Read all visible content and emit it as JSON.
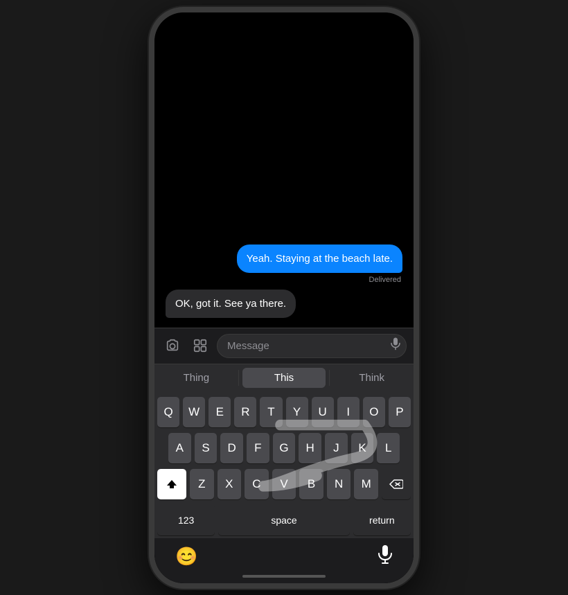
{
  "messages": [
    {
      "text": "Yeah. Staying at the beach late.",
      "type": "sent",
      "status": "Delivered"
    },
    {
      "text": "OK, got it. See ya there.",
      "type": "received"
    }
  ],
  "input": {
    "placeholder": "Message"
  },
  "autocomplete": {
    "left": "Thing",
    "center": "This",
    "right": "Think"
  },
  "keyboard": {
    "rows": [
      [
        "Q",
        "W",
        "E",
        "R",
        "T",
        "Y",
        "U",
        "I",
        "O",
        "P"
      ],
      [
        "A",
        "S",
        "D",
        "F",
        "G",
        "H",
        "J",
        "K",
        "L"
      ],
      [
        "Z",
        "X",
        "C",
        "V",
        "B",
        "N",
        "M"
      ]
    ],
    "bottom": {
      "numbers": "123",
      "space": "space",
      "return": "return"
    }
  },
  "bottom_bar": {
    "emoji_icon": "😊",
    "mic_icon": "🎤"
  }
}
